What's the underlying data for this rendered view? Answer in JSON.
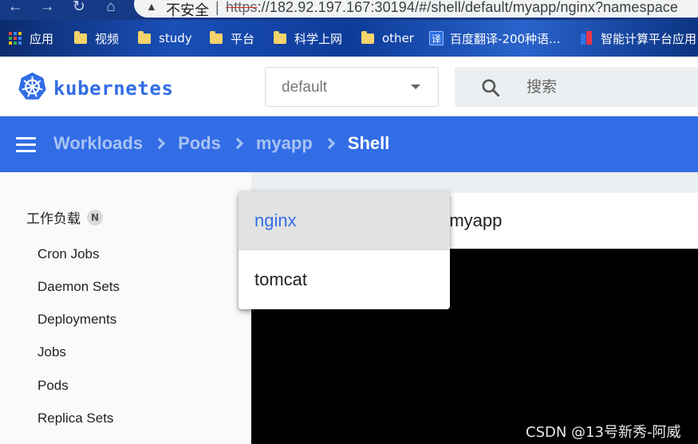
{
  "browser": {
    "security_label": "不安全",
    "url_scheme": "https",
    "url_rest": "://182.92.197.167:30194/#/shell/default/myapp/nginx?namespace"
  },
  "bookmarks": [
    {
      "label": "应用",
      "icon": "apps-icon"
    },
    {
      "label": "视频",
      "icon": "folder-icon"
    },
    {
      "label": "study",
      "icon": "folder-icon"
    },
    {
      "label": "平台",
      "icon": "folder-icon"
    },
    {
      "label": "科学上网",
      "icon": "folder-icon"
    },
    {
      "label": "other",
      "icon": "folder-icon"
    },
    {
      "label": "百度翻译-200种语...",
      "icon": "translate-icon"
    },
    {
      "label": "智能计算平台应用",
      "icon": "app-icon"
    }
  ],
  "header": {
    "brand": "kubernetes",
    "namespace": "default",
    "search_placeholder": "搜索"
  },
  "breadcrumbs": [
    "Workloads",
    "Pods",
    "myapp",
    "Shell"
  ],
  "sidebar": {
    "heading": "工作负载",
    "badge": "N",
    "items": [
      "Cron Jobs",
      "Daemon Sets",
      "Deployments",
      "Jobs",
      "Pods",
      "Replica Sets"
    ]
  },
  "main": {
    "title": "n myapp"
  },
  "dropdown": {
    "options": [
      "nginx",
      "tomcat"
    ],
    "selected": "nginx"
  },
  "watermark": "CSDN @13号新秀-阿威",
  "colors": {
    "primary": "#326de6",
    "breadcrumb_inactive": "#a8c2f4",
    "terminal_bg": "#000000"
  }
}
